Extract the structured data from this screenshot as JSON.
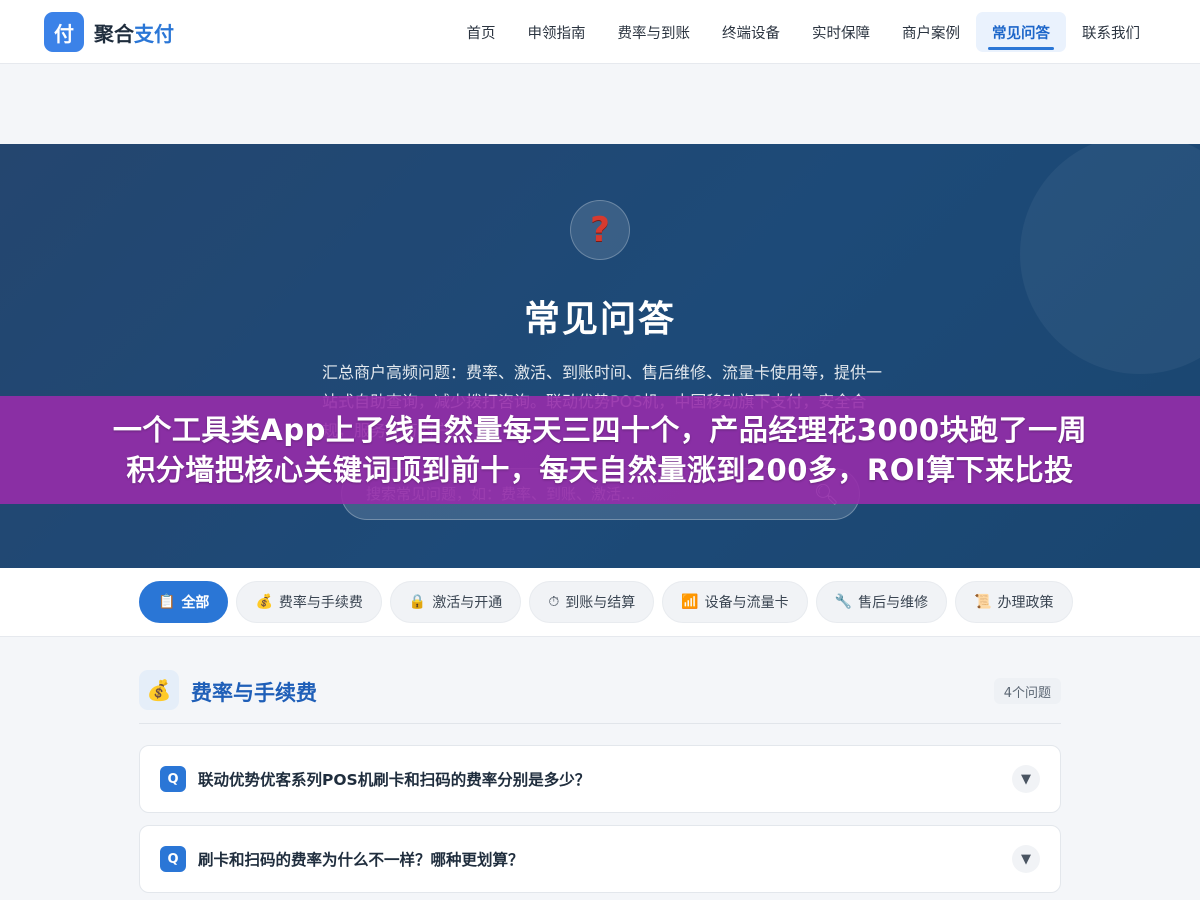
{
  "brand": {
    "mark": "付",
    "name_prefix": "聚合",
    "name_accent": "支付"
  },
  "nav": {
    "items": [
      {
        "label": "首页"
      },
      {
        "label": "申领指南"
      },
      {
        "label": "费率与到账"
      },
      {
        "label": "终端设备"
      },
      {
        "label": "实时保障"
      },
      {
        "label": "商户案例"
      },
      {
        "label": "常见问答",
        "active": true
      },
      {
        "label": "联系我们"
      }
    ]
  },
  "hero": {
    "icon": "question-mark-icon",
    "title": "常见问答",
    "description": "汇总商户高频问题：费率、激活、到账时间、售后维修、流量卡使用等，提供一站式自助查询，减少拨打咨询。联动优势POS机，中国移动旗下支付，安全合规，服务千万商户。",
    "search": {
      "placeholder": "搜索常见问题，如：费率、到账、激活..."
    }
  },
  "banner": {
    "line1": "一个工具类App上了线自然量每天三四十个，产品经理花3000块跑了一周",
    "line2": "积分墙把核心关键词顶到前十，每天自然量涨到200多，ROI算下来比投"
  },
  "filters": [
    {
      "icon": "📋",
      "label": "全部",
      "active": true
    },
    {
      "icon": "💰",
      "label": "费率与手续费"
    },
    {
      "icon": "🔒",
      "label": "激活与开通"
    },
    {
      "icon": "⏱",
      "label": "到账与结算"
    },
    {
      "icon": "📶",
      "label": "设备与流量卡"
    },
    {
      "icon": "🔧",
      "label": "售后与维修"
    },
    {
      "icon": "📜",
      "label": "办理政策"
    }
  ],
  "section": {
    "icon": "💰",
    "title": "费率与手续费",
    "count": "4个问题",
    "questions": [
      {
        "badge": "Q",
        "text": "联动优势优客系列POS机刷卡和扫码的费率分别是多少？"
      },
      {
        "badge": "Q",
        "text": "刷卡和扫码的费率为什么不一样？哪种更划算？"
      }
    ]
  },
  "colors": {
    "primary": "#2a76d6",
    "hero_bg": "#1d4a78",
    "banner_bg": "#962caa"
  }
}
